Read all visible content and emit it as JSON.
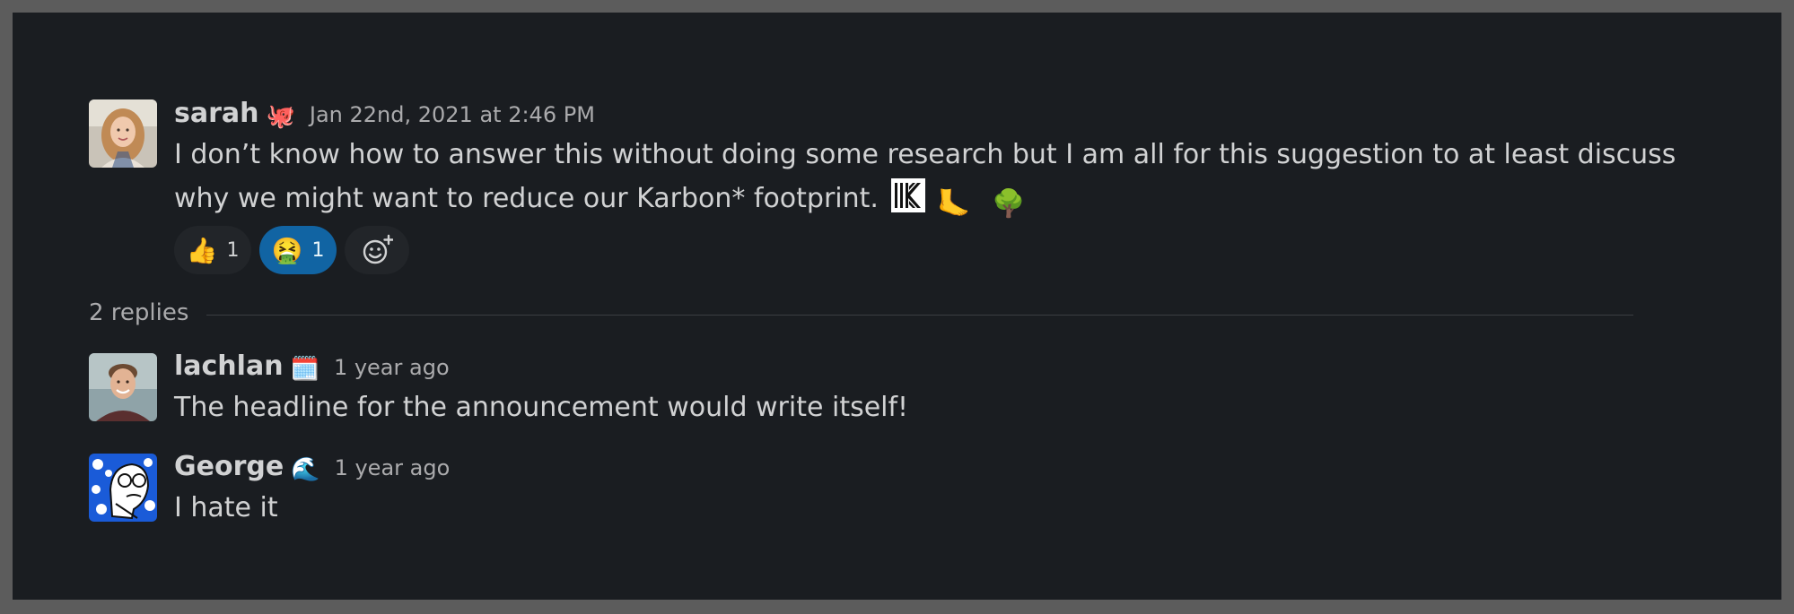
{
  "colors": {
    "background": "#1a1d21",
    "frame": "#5c5c5c",
    "text": "#d1d2d3",
    "muted": "#ababad",
    "active_reaction": "#1164a3"
  },
  "parent_message": {
    "avatar_icon": "sarah-avatar-photo",
    "username": "sarah",
    "status_emoji": "🐙",
    "timestamp": "Jan 22nd, 2021 at 2:46 PM",
    "text_line1": "I don’t know how to answer this without doing some research but I am all for this suggestion to at least discuss",
    "text_line2": "why we might want to reduce our Karbon* footprint.",
    "inline_emojis": [
      "karbon-logo-icon",
      "🦶",
      "🌳"
    ],
    "emoji_foot": "🦶",
    "emoji_tree": "🌳",
    "reactions": [
      {
        "emoji": "👍",
        "count": "1",
        "active": false
      },
      {
        "emoji": "🤮",
        "count": "1",
        "active": true
      }
    ],
    "add_reaction_icon": "add-reaction-icon"
  },
  "thread": {
    "replies_label": "2 replies",
    "replies": [
      {
        "avatar_icon": "lachlan-avatar-photo",
        "username": "lachlan",
        "status_emoji": "🗓️",
        "timestamp": "1 year ago",
        "text": "The headline for the announcement would write itself!"
      },
      {
        "avatar_icon": "george-avatar-illustration",
        "username": "George",
        "status_emoji": "🌊",
        "timestamp": "1 year ago",
        "text": "I hate it"
      }
    ]
  }
}
